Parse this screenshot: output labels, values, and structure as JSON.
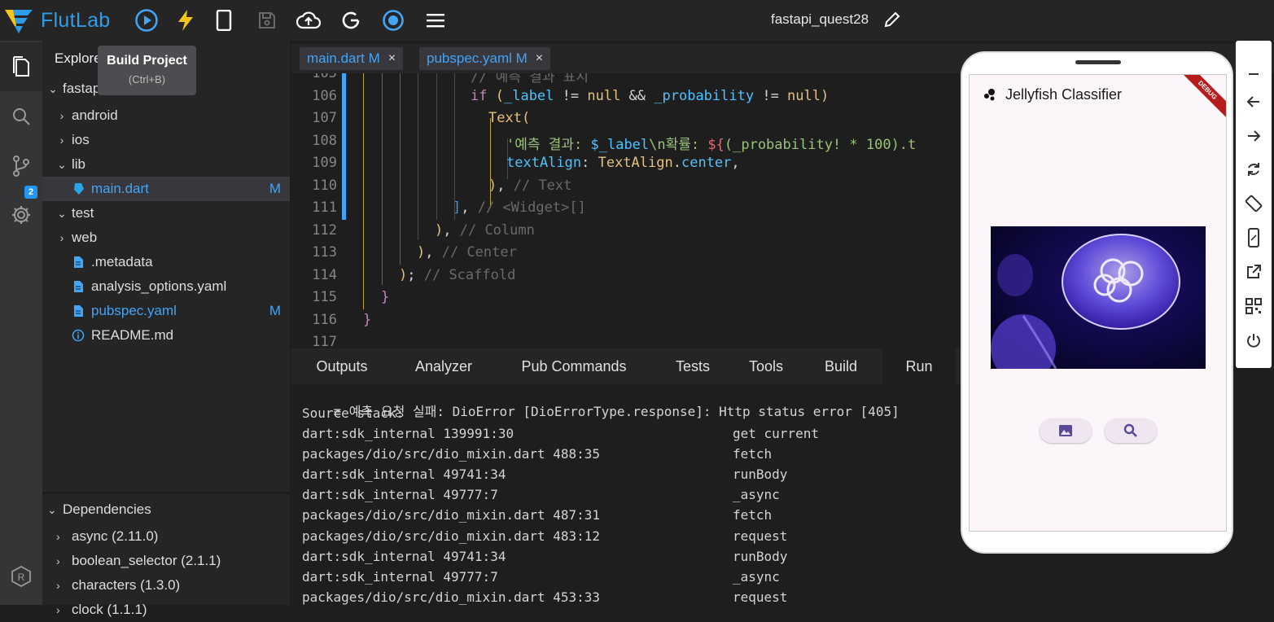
{
  "topbar": {
    "logo_text": "FlutLab",
    "project_name": "fastapi_quest28",
    "tools": [
      "run-icon",
      "build-icon",
      "device-icon",
      "save-icon",
      "cloud-upload-icon",
      "google-icon",
      "record-icon",
      "menu-icon"
    ]
  },
  "tooltip": {
    "title": "Build Project",
    "shortcut": "(Ctrl+B)"
  },
  "explorer": {
    "header": "Explore",
    "items": [
      {
        "label": "fastapi_quest28",
        "chev": "⌄",
        "indent": 0,
        "partial": "fastap"
      },
      {
        "label": "android",
        "chev": "›",
        "indent": 1
      },
      {
        "label": "ios",
        "chev": "›",
        "indent": 1
      },
      {
        "label": "lib",
        "chev": "⌄",
        "indent": 1
      },
      {
        "label": "main.dart",
        "indent": 2,
        "badge": "M",
        "selected": true
      },
      {
        "label": "test",
        "chev": "⌄",
        "indent": 1
      },
      {
        "label": "web",
        "chev": "›",
        "indent": 1
      },
      {
        "label": ".metadata",
        "indent": 2
      },
      {
        "label": "analysis_options.yaml",
        "indent": 2
      },
      {
        "label": "pubspec.yaml",
        "indent": 2,
        "badge": "M"
      },
      {
        "label": "README.md",
        "indent": 2
      }
    ]
  },
  "dependencies": {
    "header": "Dependencies",
    "items": [
      "async (2.11.0)",
      "boolean_selector (2.1.1)",
      "characters (1.3.0)",
      "clock (1.1.1)"
    ]
  },
  "editor_tabs": [
    {
      "label": "main.dart M",
      "close": "×"
    },
    {
      "label": "pubspec.yaml M",
      "close": "×"
    }
  ],
  "editor": {
    "lines": [
      {
        "n": "105",
        "code": "// 예측 결과 표시"
      },
      {
        "n": "106",
        "code": "if (_label != null && _probability != null)"
      },
      {
        "n": "107",
        "code": "Text("
      },
      {
        "n": "108",
        "code": "'예측 결과: $_label\\n확률: ${(_probability! * 100).t"
      },
      {
        "n": "109",
        "code": "textAlign: TextAlign.center,"
      },
      {
        "n": "110",
        "code": "), // Text"
      },
      {
        "n": "111",
        "code": "], // <Widget>[]"
      },
      {
        "n": "112",
        "code": "), // Column"
      },
      {
        "n": "113",
        "code": "), // Center"
      },
      {
        "n": "114",
        "code": "); // Scaffold"
      },
      {
        "n": "115",
        "code": "}"
      },
      {
        "n": "116",
        "code": "}"
      },
      {
        "n": "117",
        "code": ""
      }
    ]
  },
  "panel": {
    "tabs": [
      "Outputs",
      "Analyzer",
      "Pub Commands",
      "Tests",
      "Tools",
      "Build",
      "Run"
    ],
    "active": "Run"
  },
  "console": {
    "error_line": "예측 요청 실패: DioError [DioErrorType.response]: Http status error [405]",
    "source_stack_label": "Source stack:",
    "stack": [
      [
        "dart:sdk_internal 139991:30",
        "get current"
      ],
      [
        "packages/dio/src/dio_mixin.dart 488:35",
        "fetch"
      ],
      [
        "dart:sdk_internal 49741:34",
        "runBody"
      ],
      [
        "dart:sdk_internal 49777:7",
        "_async"
      ],
      [
        "packages/dio/src/dio_mixin.dart 487:31",
        "fetch"
      ],
      [
        "packages/dio/src/dio_mixin.dart 483:12",
        "request"
      ],
      [
        "dart:sdk_internal 49741:34",
        "runBody"
      ],
      [
        "dart:sdk_internal 49777:7",
        "_async"
      ],
      [
        "packages/dio/src/dio_mixin.dart 453:33",
        "request"
      ]
    ]
  },
  "preview": {
    "app_title": "Jellyfish Classifier",
    "debug_label": "DEBUG",
    "buttons": [
      "image-icon",
      "search-icon"
    ]
  },
  "side_tools": [
    "minimize-icon",
    "back-icon",
    "forward-icon",
    "refresh-icon",
    "rotate-icon",
    "device-frame-icon",
    "open-external-icon",
    "qr-code-icon",
    "power-icon"
  ],
  "colors": {
    "accent": "#42a5f5",
    "background": "#1e1e1e",
    "panel": "#252526"
  }
}
